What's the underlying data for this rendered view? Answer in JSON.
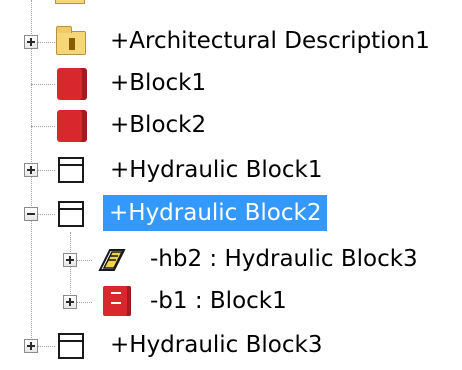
{
  "tree": {
    "nodes": [
      {
        "label": "+Architectural Description1",
        "icon": "folder-icon",
        "expander": "plus"
      },
      {
        "label": "+Block1",
        "icon": "block-icon",
        "expander": "none"
      },
      {
        "label": "+Block2",
        "icon": "block-icon",
        "expander": "none"
      },
      {
        "label": "+Hydraulic Block1",
        "icon": "block-outline-icon",
        "expander": "plus"
      },
      {
        "label": "+Hydraulic Block2",
        "icon": "block-outline-icon",
        "expander": "minus",
        "selected": true
      },
      {
        "label": "-hb2 : Hydraulic Block3",
        "icon": "part-property-icon",
        "expander": "plus"
      },
      {
        "label": "-b1 : Block1",
        "icon": "block-icon",
        "expander": "plus"
      },
      {
        "label": "+Hydraulic Block3",
        "icon": "block-outline-icon",
        "expander": "plus"
      }
    ]
  },
  "colors": {
    "selection": "#3399ff",
    "block_red": "#d9272e",
    "folder_yellow": "#f5d77a",
    "tree_lines": "#a0a0a0"
  }
}
